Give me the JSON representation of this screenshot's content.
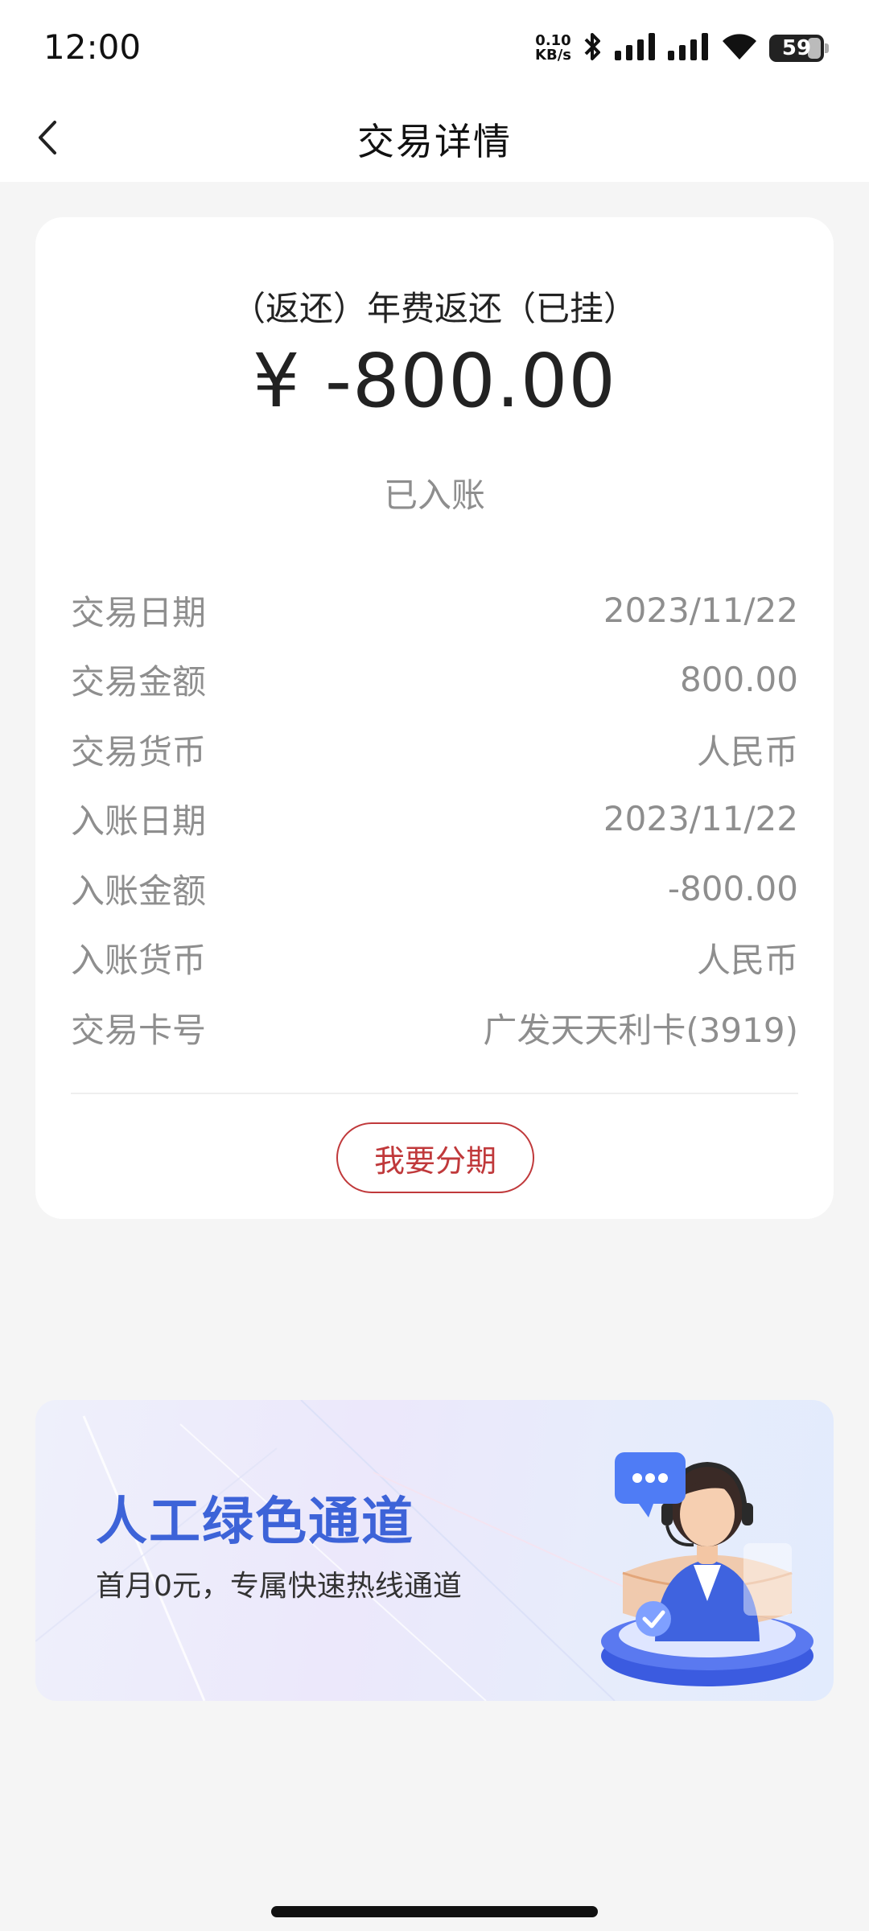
{
  "status_bar": {
    "time": "12:00",
    "net_speed_value": "0.10",
    "net_speed_unit": "KB/s",
    "battery": "59",
    "icons": [
      "bluetooth-icon",
      "signal-icon",
      "signal-icon",
      "wifi-icon",
      "battery-icon"
    ]
  },
  "header": {
    "back_icon": "chevron-left-icon",
    "title": "交易详情"
  },
  "transaction": {
    "title": "（返还）年费返还（已挂）",
    "amount": "¥ -800.00",
    "status": "已入账",
    "details": [
      {
        "label": "交易日期",
        "value": "2023/11/22"
      },
      {
        "label": "交易金额",
        "value": "800.00"
      },
      {
        "label": "交易货币",
        "value": "人民币"
      },
      {
        "label": "入账日期",
        "value": "2023/11/22"
      },
      {
        "label": "入账金额",
        "value": "-800.00"
      },
      {
        "label": "入账货币",
        "value": "人民币"
      },
      {
        "label": "交易卡号",
        "value": "广发天天利卡(3919)"
      }
    ],
    "installment_button": "我要分期"
  },
  "banner": {
    "title": "人工绿色通道",
    "subtitle": "首月0元，专属快速热线通道",
    "illustration": "customer-service-agent-icon"
  },
  "colors": {
    "accent_red": "#c0393b",
    "banner_blue": "#3d63d8",
    "page_bg": "#f5f5f5"
  }
}
